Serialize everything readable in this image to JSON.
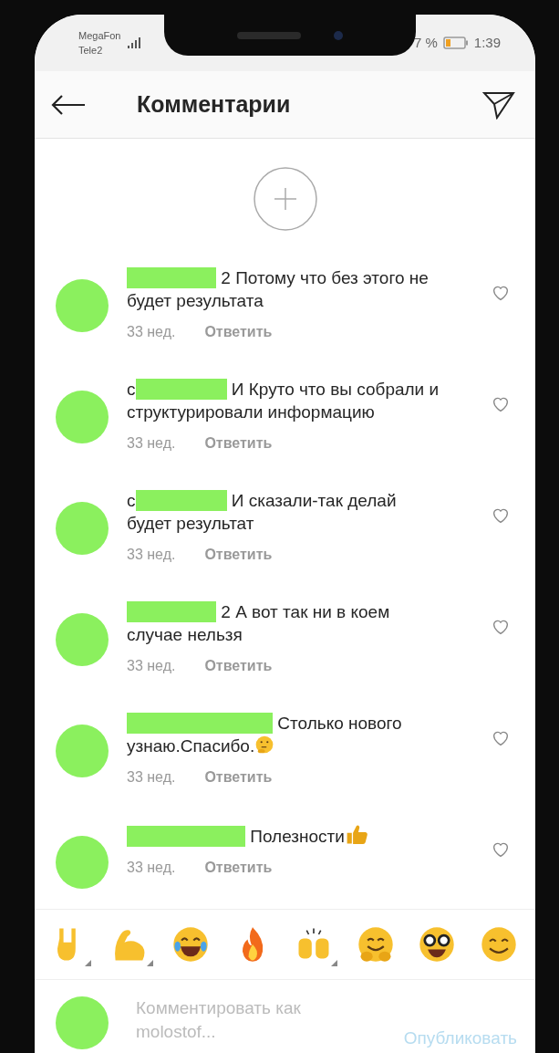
{
  "status_bar": {
    "carriers": [
      "MegaFon",
      "Tele2"
    ],
    "battery_text": "7 %",
    "time": "1:39"
  },
  "header": {
    "title": "Комментарии"
  },
  "comments": [
    {
      "text": "2 Потому что без этого не будет результата",
      "time": "33 нед.",
      "reply": "Ответить"
    },
    {
      "before": "с",
      "text": "И Круто что вы собрали и структурировали информацию",
      "time": "33 нед.",
      "reply": "Ответить"
    },
    {
      "before": "с",
      "text": "И сказали-так делай будет результат",
      "time": "33 нед.",
      "reply": "Ответить"
    },
    {
      "text": "2 А вот так ни в коем случае нельзя",
      "time": "33 нед.",
      "reply": "Ответить"
    },
    {
      "text": "Столько нового узнаю.Спасибо.",
      "emoji": {
        "kind": "thinking"
      },
      "time": "33 нед.",
      "reply": "Ответить"
    },
    {
      "text": "Полезности",
      "emoji": {
        "kind": "thumbs"
      },
      "time": "33 нед.",
      "reply": "Ответить"
    }
  ],
  "emoji_bar": [
    {
      "kind": "horns",
      "variants": true
    },
    {
      "kind": "biceps",
      "variants": true
    },
    {
      "kind": "joy",
      "variants": false
    },
    {
      "kind": "fire",
      "variants": false
    },
    {
      "kind": "hands",
      "variants": true
    },
    {
      "kind": "hug",
      "variants": false
    },
    {
      "kind": "nerd",
      "variants": false
    },
    {
      "kind": "smile",
      "variants": false
    }
  ],
  "composer": {
    "placeholder": "Комментировать как molostof...",
    "post": "Опубликовать"
  }
}
